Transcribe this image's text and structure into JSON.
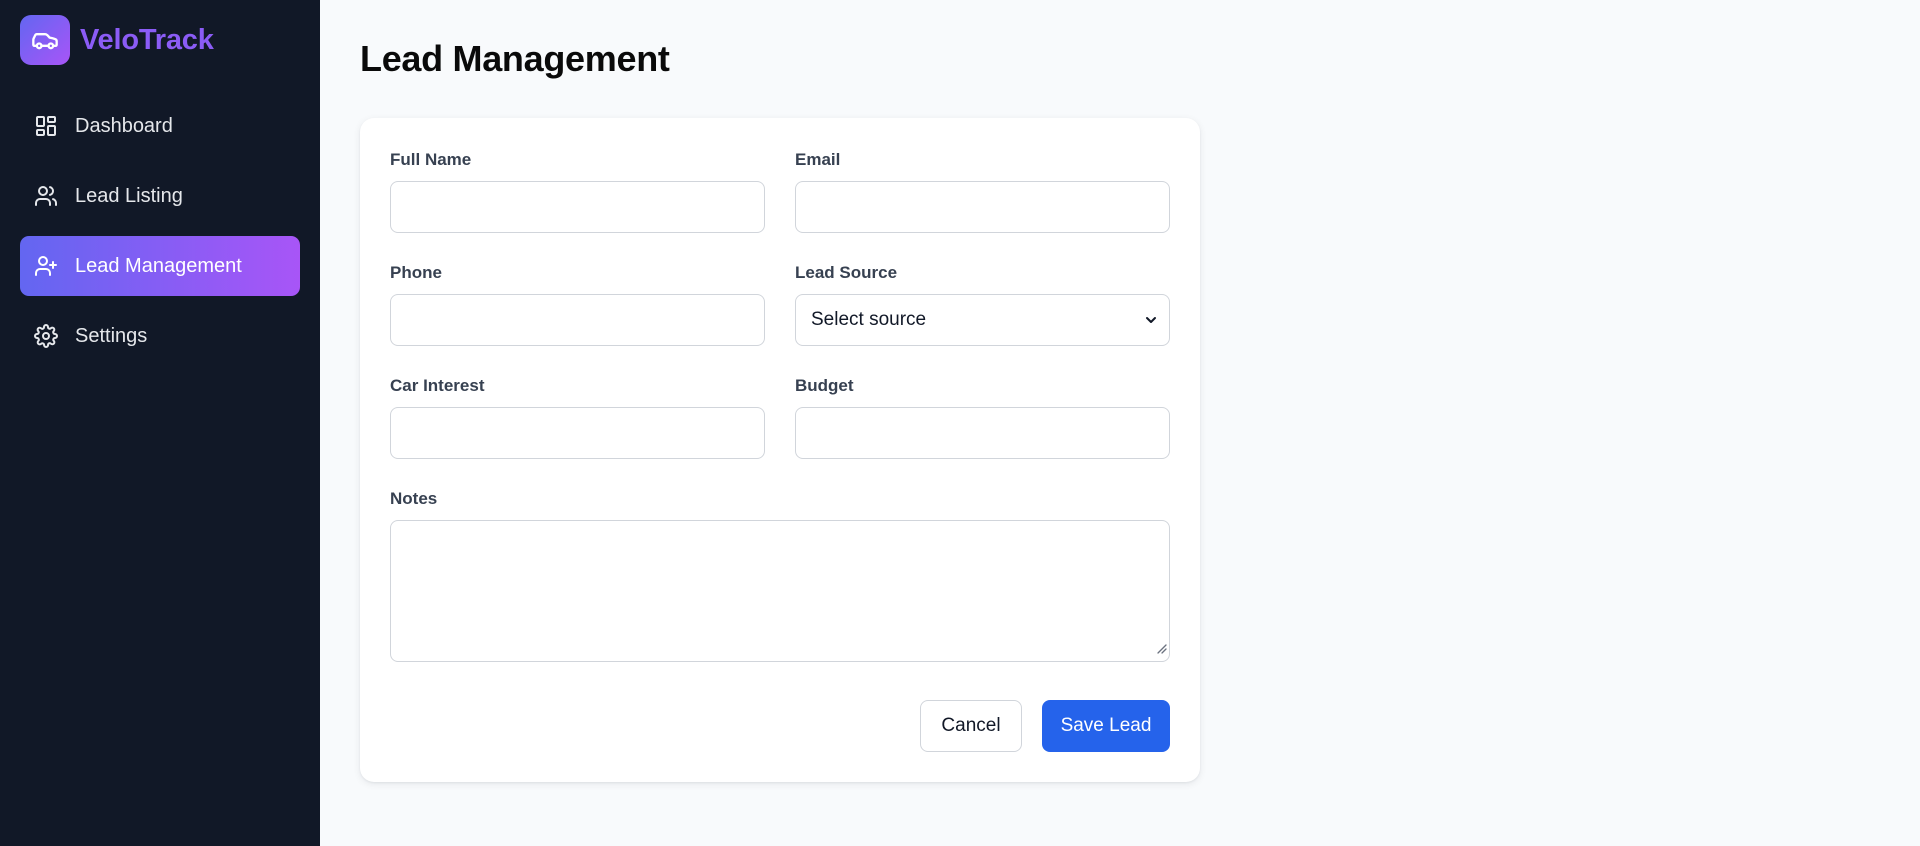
{
  "app": {
    "name": "VeloTrack",
    "logo_icon": "car-icon"
  },
  "sidebar": {
    "items": [
      {
        "label": "Dashboard",
        "icon": "dashboard-icon",
        "active": false
      },
      {
        "label": "Lead Listing",
        "icon": "users-icon",
        "active": false
      },
      {
        "label": "Lead Management",
        "icon": "user-plus-icon",
        "active": true
      },
      {
        "label": "Settings",
        "icon": "gear-icon",
        "active": false
      }
    ]
  },
  "page": {
    "title": "Lead Management"
  },
  "form": {
    "full_name": {
      "label": "Full Name",
      "value": ""
    },
    "email": {
      "label": "Email",
      "value": ""
    },
    "phone": {
      "label": "Phone",
      "value": ""
    },
    "lead_source": {
      "label": "Lead Source",
      "value": "Select source"
    },
    "car_interest": {
      "label": "Car Interest",
      "value": ""
    },
    "budget": {
      "label": "Budget",
      "value": ""
    },
    "notes": {
      "label": "Notes",
      "value": ""
    },
    "cancel_label": "Cancel",
    "save_label": "Save Lead"
  },
  "colors": {
    "sidebar_bg": "#111827",
    "accent_gradient_start": "#6366f1",
    "accent_gradient_end": "#a855f7",
    "primary_button": "#2563eb",
    "page_bg": "#f8fafc"
  }
}
